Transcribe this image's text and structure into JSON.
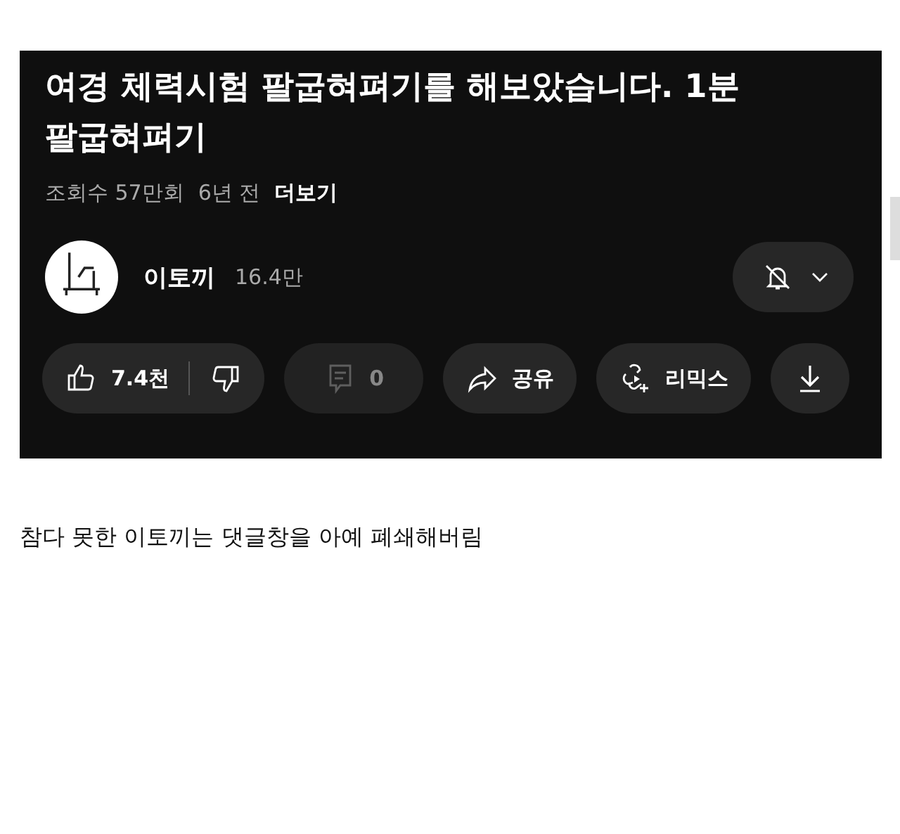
{
  "video": {
    "title": "여경 체력시험 팔굽혀펴기를 해보았습니다.  1분 팔굽혀펴기",
    "views": "조회수 57만회",
    "age": "6년 전",
    "more": "더보기",
    "channel": {
      "name": "이토끼",
      "subscribers": "16.4만",
      "notifications_on": false
    },
    "actions": [
      {
        "kind": "like",
        "label": "7.4천",
        "disabled": false
      },
      {
        "kind": "comments",
        "label": "0",
        "disabled": true
      },
      {
        "kind": "share",
        "label": "공유",
        "disabled": false
      },
      {
        "kind": "remix",
        "label": "리믹스",
        "disabled": false
      },
      {
        "kind": "download",
        "disabled": false
      }
    ]
  },
  "caption": "참다 못한 이토끼는 댓글창을 아예 폐쇄해버림"
}
